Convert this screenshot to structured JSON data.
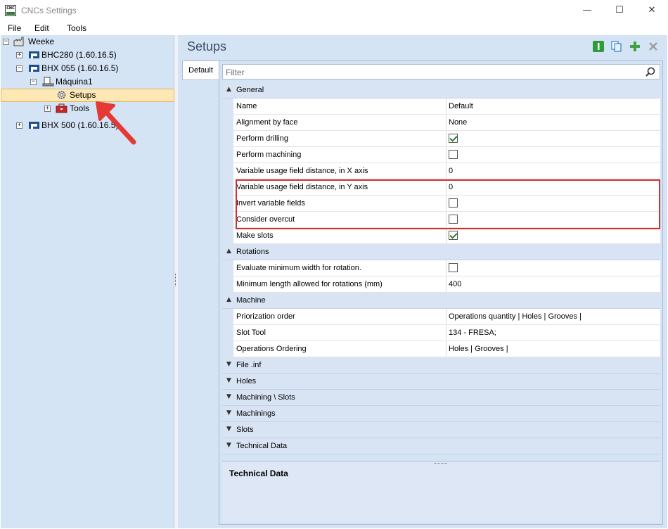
{
  "window": {
    "title": "CNCs Settings",
    "app_icon_text": "CNC",
    "minimize": "—",
    "maximize": "☐",
    "close": "✕"
  },
  "menu": {
    "items": [
      "File",
      "Edit",
      "Tools"
    ]
  },
  "tree": {
    "root": "Weeke",
    "nodes": [
      {
        "label": "BHC280 (1.60.16.5)",
        "expander": "+"
      },
      {
        "label": "BHX 055 (1.60.16.5)",
        "expander": "−"
      },
      {
        "label": "Máquina1",
        "expander": "−"
      },
      {
        "label": "Setups"
      },
      {
        "label": "Tools",
        "expander": "+"
      },
      {
        "label": "BHX 500 (1.60.16.5)",
        "expander": "+"
      }
    ],
    "root_expander": "−"
  },
  "panel": {
    "title": "Setups",
    "tab": "Default",
    "filter_placeholder": "Filter"
  },
  "grid": {
    "general": {
      "label": "General",
      "rows": [
        {
          "name": "Name",
          "value": "Default"
        },
        {
          "name": "Alignment by face",
          "value": "None"
        },
        {
          "name": "Perform drilling",
          "checked": true
        },
        {
          "name": "Perform machining",
          "checked": false
        },
        {
          "name": "Variable usage field distance, in X axis",
          "value": "0"
        },
        {
          "name": "Variable usage field distance, in Y axis",
          "value": "0"
        },
        {
          "name": "Invert variable fields",
          "checked": false
        },
        {
          "name": "Consider overcut",
          "checked": false
        },
        {
          "name": "Make slots",
          "checked": true
        }
      ]
    },
    "rotations": {
      "label": "Rotations",
      "rows": [
        {
          "name": "Evaluate minimum width for rotation.",
          "checked": false
        },
        {
          "name": "Minimum length allowed for rotations (mm)",
          "value": "400"
        }
      ]
    },
    "machine": {
      "label": "Machine",
      "rows": [
        {
          "name": "Priorization order",
          "value": "Operations quantity | Holes | Grooves |"
        },
        {
          "name": "Slot Tool",
          "value": "134 - FRESA;"
        },
        {
          "name": "Operations Ordering",
          "value": "Holes | Grooves |"
        }
      ]
    },
    "collapsed": [
      "File .inf",
      "Holes",
      "Machining \\ Slots",
      "Machinings",
      "Slots",
      "Technical Data"
    ]
  },
  "description": {
    "title": "Technical Data"
  },
  "colors": {
    "panel_bg": "#d5e4f5",
    "selection": "#fde7b5",
    "highlight": "#d32f2f",
    "check": "#2e7d32"
  }
}
